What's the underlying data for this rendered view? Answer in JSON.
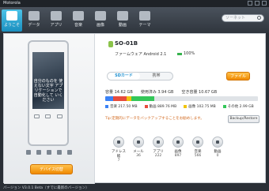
{
  "window": {
    "title": "Motorola"
  },
  "tabs": [
    {
      "label": "ようこそ",
      "icon": "home-icon",
      "active": true
    },
    {
      "label": "データ",
      "icon": "data-icon",
      "active": false
    },
    {
      "label": "アプリ",
      "icon": "apps-icon",
      "active": false
    },
    {
      "label": "音楽",
      "icon": "music-icon",
      "active": false
    },
    {
      "label": "画像",
      "icon": "image-icon",
      "active": false
    },
    {
      "label": "動画",
      "icon": "video-icon",
      "active": false
    },
    {
      "label": "テーマ",
      "icon": "theme-icon",
      "active": false
    }
  ],
  "search": {
    "placeholder": "ソーネット"
  },
  "phone": {
    "screen_caption": "自分のものを 使えない文字 アプリケーションで 自動化して いください"
  },
  "device_button": {
    "label": "デバイス切替"
  },
  "device": {
    "name": "SO-01B",
    "firmware": "ファームウェア Android 2.1",
    "battery": "100%"
  },
  "storage_tabs": {
    "sd_label": "SDカード",
    "phone_label": "携帯"
  },
  "file_button": {
    "label": "ファイル"
  },
  "capacity": {
    "total": "容量 14.62 GB",
    "used": "使用済み 3.94 GB",
    "free": "空き容量 10.67 GB"
  },
  "usage": {
    "segments": [
      {
        "label": "音楽 217.50 MB",
        "color": "#3b82f6",
        "fraction": 0.05
      },
      {
        "label": "動画 889.76 MB",
        "color": "#e74c3c",
        "fraction": 0.09
      },
      {
        "label": "画像 102.75 MB",
        "color": "#f1c40f",
        "fraction": 0.03
      },
      {
        "label": "その他 2.99 GB",
        "color": "#34c759",
        "fraction": 0.15
      }
    ]
  },
  "tip": "Tip:定期的にデータをバックアップすることをお勧めします。",
  "backup_button": {
    "label": "Backup/Restore"
  },
  "stats": [
    {
      "label": "アドレス帳",
      "count": "7"
    },
    {
      "label": "メール",
      "count": "36"
    },
    {
      "label": "アプリ",
      "count": "222"
    },
    {
      "label": "画像",
      "count": "897"
    },
    {
      "label": "音楽",
      "count": "566"
    },
    {
      "label": "動画",
      "count": "0"
    }
  ],
  "statusbar": {
    "text": "バージョン V3.0.1 Beta（すでに最新のバージョン）"
  }
}
